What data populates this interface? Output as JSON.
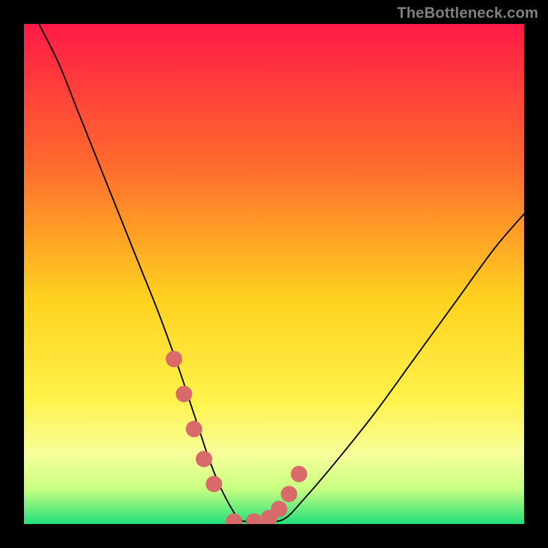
{
  "watermark": "TheBottleneck.com",
  "chart_data": {
    "type": "line",
    "title": "",
    "xlabel": "",
    "ylabel": "",
    "xlim": [
      0,
      100
    ],
    "ylim": [
      0,
      100
    ],
    "background_gradient": {
      "stops": [
        {
          "offset": 0,
          "color": "#ff1a47"
        },
        {
          "offset": 0.28,
          "color": "#ff6a2e"
        },
        {
          "offset": 0.55,
          "color": "#ffd21f"
        },
        {
          "offset": 0.75,
          "color": "#fff24a"
        },
        {
          "offset": 0.86,
          "color": "#f8ff9a"
        },
        {
          "offset": 0.93,
          "color": "#c8ff82"
        },
        {
          "offset": 1.0,
          "color": "#21e07a"
        }
      ]
    },
    "series": [
      {
        "name": "bottleneck-curve",
        "color": "#000000",
        "width": 2,
        "x": [
          3,
          7,
          11,
          15,
          19,
          23,
          27,
          31,
          33,
          35,
          37,
          39,
          41,
          43,
          45,
          48,
          52,
          56,
          62,
          70,
          78,
          86,
          94,
          100
        ],
        "y": [
          100,
          92,
          82,
          72,
          62,
          52,
          42,
          31,
          25,
          19,
          13,
          8,
          4,
          1,
          0.5,
          0.5,
          1,
          5,
          12,
          22,
          33,
          44,
          55,
          62
        ]
      }
    ],
    "highlight": {
      "name": "optimal-range-marker",
      "color": "#d86a6a",
      "radius": 12,
      "x": [
        30,
        32,
        34,
        36,
        38,
        42,
        46,
        49,
        51,
        53,
        55
      ],
      "y": [
        33,
        26,
        19,
        13,
        8,
        0.5,
        0.5,
        1.2,
        3,
        6,
        10
      ]
    }
  }
}
